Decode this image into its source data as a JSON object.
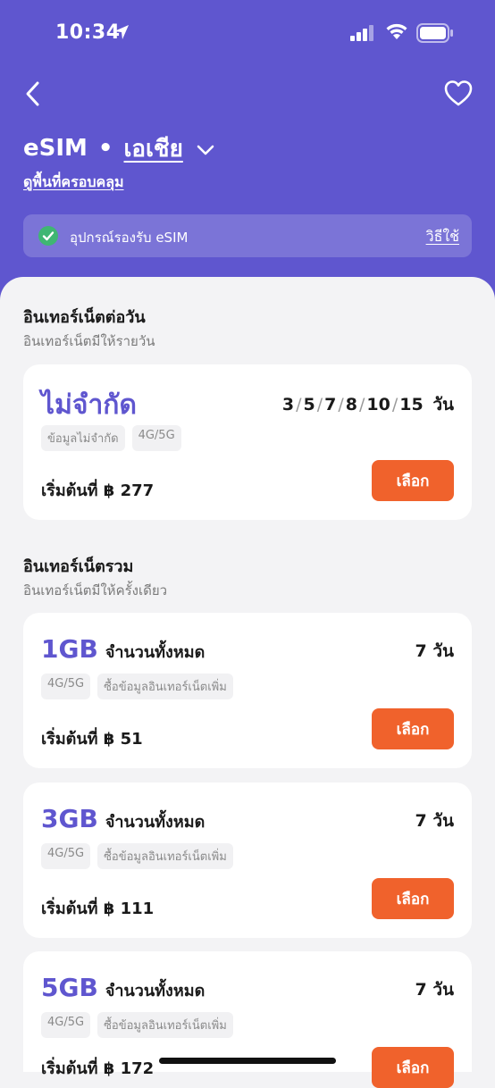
{
  "status_bar": {
    "time": "10:34"
  },
  "header": {
    "title_esim": "eSIM",
    "title_dot": "•",
    "region": "เอเชีย",
    "coverage_link": "ดูพื้นที่ครอบคลุม",
    "compat_text": "อุปกรณ์รองรับ eSIM",
    "howto_link": "วิธีใช้"
  },
  "sections": {
    "daily": {
      "title": "อินเทอร์เน็ตต่อวัน",
      "subtitle": "อินเทอร์เน็ตมีให้รายวัน"
    },
    "total": {
      "title": "อินเทอร์เน็ตรวม",
      "subtitle": "อินเทอร์เน็ตมีให้ครั้งเดียว"
    }
  },
  "plans": [
    {
      "name": "ไม่จำกัด",
      "days": [
        "3",
        "5",
        "7",
        "8",
        "10",
        "15"
      ],
      "day_unit": "วัน",
      "tags": [
        "ข้อมูลไม่จำกัด",
        "4G/5G"
      ],
      "price": "เริ่มต้นที่ ฿ 277",
      "button": "เลือก"
    },
    {
      "gb": "1GB",
      "suffix": "จำนวนทั้งหมด",
      "days_label": "7 วัน",
      "tags": [
        "4G/5G",
        "ซื้อข้อมูลอินเทอร์เน็ตเพิ่ม"
      ],
      "price": "เริ่มต้นที่ ฿ 51",
      "button": "เลือก"
    },
    {
      "gb": "3GB",
      "suffix": "จำนวนทั้งหมด",
      "days_label": "7 วัน",
      "tags": [
        "4G/5G",
        "ซื้อข้อมูลอินเทอร์เน็ตเพิ่ม"
      ],
      "price": "เริ่มต้นที่ ฿ 111",
      "button": "เลือก"
    },
    {
      "gb": "5GB",
      "suffix": "จำนวนทั้งหมด",
      "days_label": "7 วัน",
      "tags": [
        "4G/5G",
        "ซื้อข้อมูลอินเทอร์เน็ตเพิ่ม"
      ],
      "price": "เริ่มต้นที่ ฿ 172",
      "button": "เลือก"
    }
  ],
  "colors": {
    "brand": "#5f56cf",
    "button": "#f0622c",
    "check": "#3fb673"
  },
  "icons": [
    "location-arrow-icon",
    "signal-icon",
    "wifi-icon",
    "battery-icon",
    "back-chevron-icon",
    "heart-icon",
    "chevron-down-icon",
    "check-circle-icon"
  ]
}
